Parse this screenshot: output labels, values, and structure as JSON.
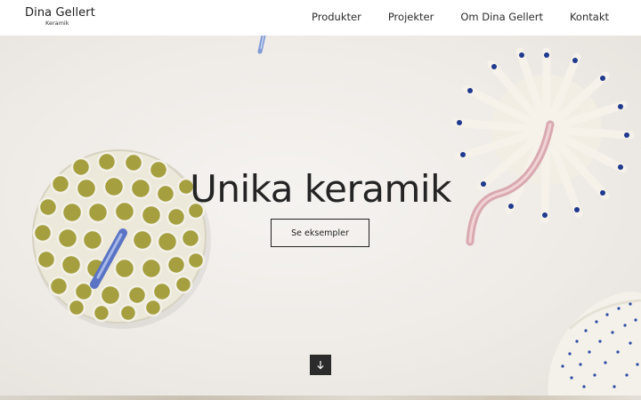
{
  "brand": {
    "name": "Dina Gellert",
    "subtitle": "Keramik"
  },
  "nav": [
    {
      "label": "Produkter"
    },
    {
      "label": "Projekter"
    },
    {
      "label": "Om Dina Gellert"
    },
    {
      "label": "Kontakt"
    }
  ],
  "hero": {
    "title": "Unika keramik",
    "button_label": "Se eksempler",
    "scroll_icon": "arrow-down-icon"
  },
  "colors": {
    "header_bg": "#ffffff",
    "hero_bg": "#efece8",
    "text": "#242424",
    "scroll_button_bg": "#2b2b2b",
    "ceramic_olive": "#a19a3a",
    "ceramic_blue": "#2a3f9a",
    "ceramic_pink": "#e1b7bd"
  }
}
